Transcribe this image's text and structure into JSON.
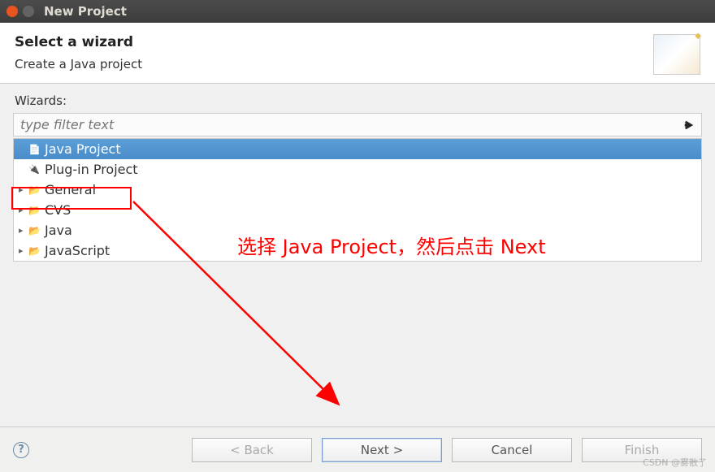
{
  "titlebar": {
    "title": "New Project"
  },
  "header": {
    "title": "Select a wizard",
    "subtitle": "Create a Java project"
  },
  "wizards": {
    "label": "Wizards:",
    "filter_placeholder": "type filter text",
    "items": [
      {
        "label": "Java Project",
        "icon": "project",
        "selected": true,
        "expandable": false
      },
      {
        "label": "Plug-in Project",
        "icon": "plugin",
        "selected": false,
        "expandable": false
      },
      {
        "label": "General",
        "icon": "folder",
        "selected": false,
        "expandable": true
      },
      {
        "label": "CVS",
        "icon": "folder",
        "selected": false,
        "expandable": true
      },
      {
        "label": "Java",
        "icon": "folder",
        "selected": false,
        "expandable": true
      },
      {
        "label": "JavaScript",
        "icon": "folder",
        "selected": false,
        "expandable": true
      }
    ]
  },
  "footer": {
    "back": "< Back",
    "next": "Next >",
    "cancel": "Cancel",
    "finish": "Finish"
  },
  "annotation": {
    "text": "选择 Java Project，然后点击 Next"
  },
  "watermark": "CSDN @雾散了"
}
